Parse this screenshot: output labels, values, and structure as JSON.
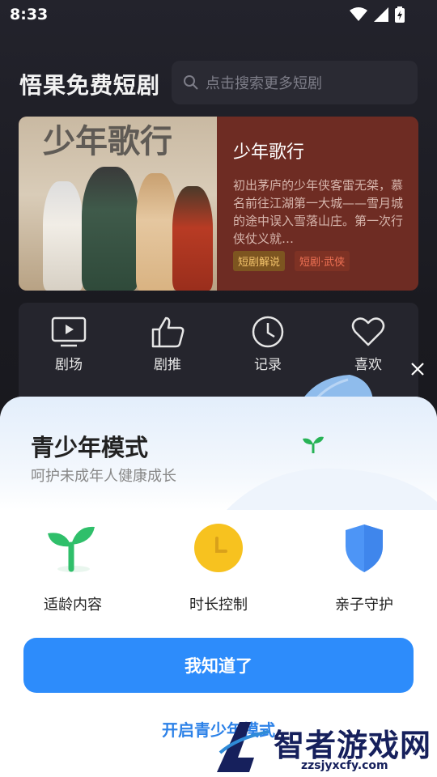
{
  "status_bar": {
    "time": "8:33"
  },
  "header": {
    "title": "悟果免费短剧",
    "search_placeholder": "点击搜索更多短剧"
  },
  "banner": {
    "title": "少年歌行",
    "description": "初出茅庐的少年侠客雷无桀，慕名前往江湖第一大城——雪月城的途中误入雪落山庄。第一次行侠仗义就…",
    "tags": [
      "短剧解说",
      "短剧·武侠"
    ]
  },
  "grid": {
    "items": [
      {
        "label": "剧场",
        "icon": "tv-play-icon"
      },
      {
        "label": "剧推",
        "icon": "thumbs-up-icon"
      },
      {
        "label": "记录",
        "icon": "clock-icon"
      },
      {
        "label": "喜欢",
        "icon": "heart-icon"
      }
    ]
  },
  "modal": {
    "title": "青少年模式",
    "subtitle": "呵护未成年人健康成长",
    "features": [
      {
        "label": "适龄内容",
        "icon": "sprout-icon"
      },
      {
        "label": "时长控制",
        "icon": "clock-icon"
      },
      {
        "label": "亲子守护",
        "icon": "shield-icon"
      }
    ],
    "confirm_label": "我知道了",
    "enable_label": "开启青少年模式"
  },
  "watermark": {
    "brand": "智者游戏网",
    "url": "zzsjyxcfy.com"
  },
  "colors": {
    "accent": "#2d8cfb",
    "banner_bg": "#6e2c23",
    "link": "#2d82e8"
  }
}
